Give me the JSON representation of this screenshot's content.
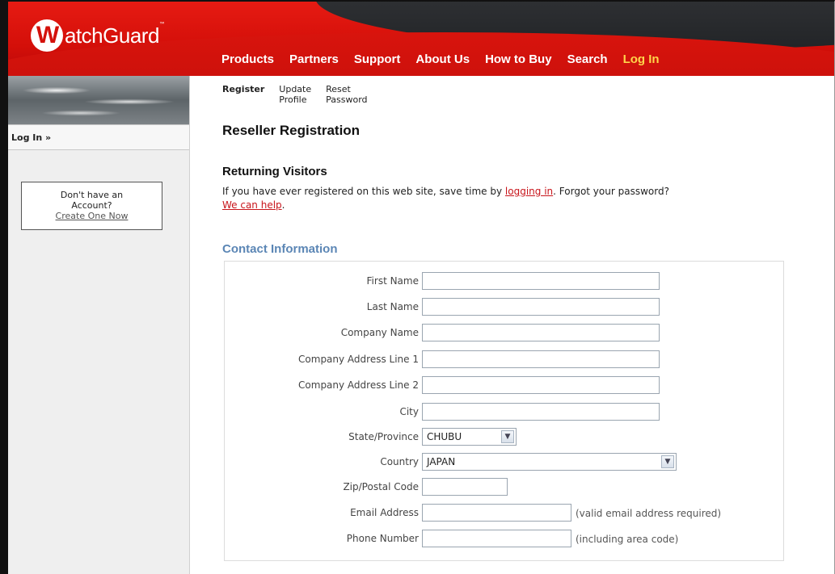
{
  "brand": {
    "logo_letter": "W",
    "logo_text": "atchGuard",
    "logo_tm": "™"
  },
  "topnav": {
    "items": [
      "Products",
      "Partners",
      "Support",
      "About Us",
      "How to Buy",
      "Search"
    ],
    "login": "Log In"
  },
  "sidebar": {
    "login_link": "Log In »",
    "signup_line1": "Don't have an",
    "signup_line2": "Account?",
    "signup_link": "Create One Now"
  },
  "subnav": {
    "register": "Register",
    "update_1": "Update",
    "update_2": "Profile",
    "reset_1": "Reset",
    "reset_2": "Password"
  },
  "page": {
    "title": "Reseller Registration",
    "returning_title": "Returning Visitors",
    "returning_text_1": "If you have ever registered on this web site, save time by ",
    "returning_link_1": "logging in",
    "returning_text_2": ". Forgot your password? ",
    "returning_link_2": "We can help",
    "returning_text_3": ".",
    "contact_title": "Contact Information"
  },
  "form": {
    "first_name": {
      "label": "First Name",
      "value": ""
    },
    "last_name": {
      "label": "Last Name",
      "value": ""
    },
    "company_name": {
      "label": "Company Name",
      "value": ""
    },
    "address1": {
      "label": "Company Address Line 1",
      "value": ""
    },
    "address2": {
      "label": "Company Address Line 2",
      "value": ""
    },
    "city": {
      "label": "City",
      "value": ""
    },
    "state": {
      "label": "State/Province",
      "value": "CHUBU"
    },
    "country": {
      "label": "Country",
      "value": "JAPAN"
    },
    "zip": {
      "label": "Zip/Postal Code",
      "value": ""
    },
    "email": {
      "label": "Email Address",
      "value": "",
      "hint": "(valid email address required)"
    },
    "phone": {
      "label": "Phone Number",
      "value": "",
      "hint": "(including area code)"
    }
  },
  "colors": {
    "header_red": "#d40f09",
    "login_yellow": "#ffd54a",
    "section_blue": "#5b86b5",
    "link_red": "#c8151b"
  },
  "icons": {
    "dropdown": "chevron-down-icon"
  }
}
